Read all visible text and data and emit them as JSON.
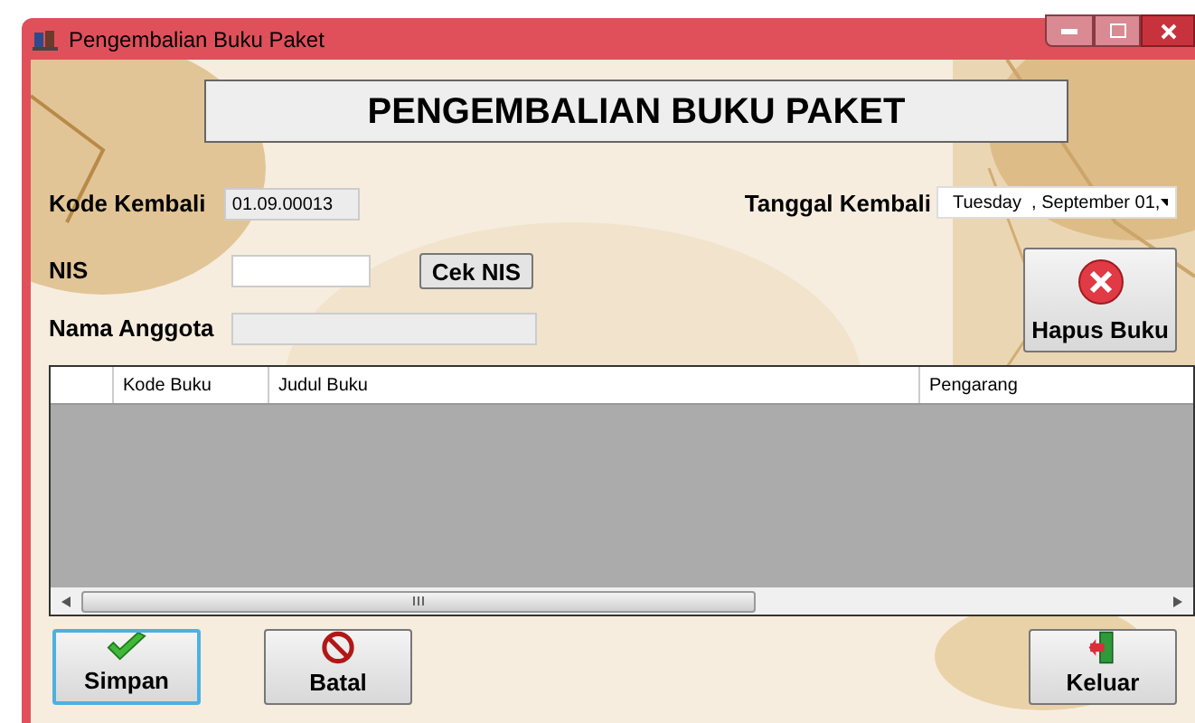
{
  "window": {
    "title": "Pengembalian Buku Paket"
  },
  "heading": "PENGEMBALIAN BUKU PAKET",
  "kode_kembali": {
    "label": "Kode Kembali",
    "value": "01.09.00013",
    "disabled": true
  },
  "tanggal_kembali": {
    "label": "Tanggal Kembali",
    "value": "Tuesday  , September 01,"
  },
  "nis": {
    "label": "NIS",
    "disabled": false
  },
  "cek_nis": {
    "label": "Cek NIS"
  },
  "nama_anggota": {
    "label": "Nama Anggota",
    "disabled": true
  },
  "hapus_buku": {
    "label": "Hapus Buku"
  },
  "table": {
    "columns": [
      "Kode Buku",
      "Judul Buku",
      "Pengarang"
    ]
  },
  "buttons": [
    {
      "label": "Simpan",
      "kind": "save",
      "selected": true
    },
    {
      "label": "Batal",
      "kind": "cancel",
      "selected": false
    },
    {
      "label": "Keluar",
      "kind": "exit",
      "selected": false
    }
  ]
}
